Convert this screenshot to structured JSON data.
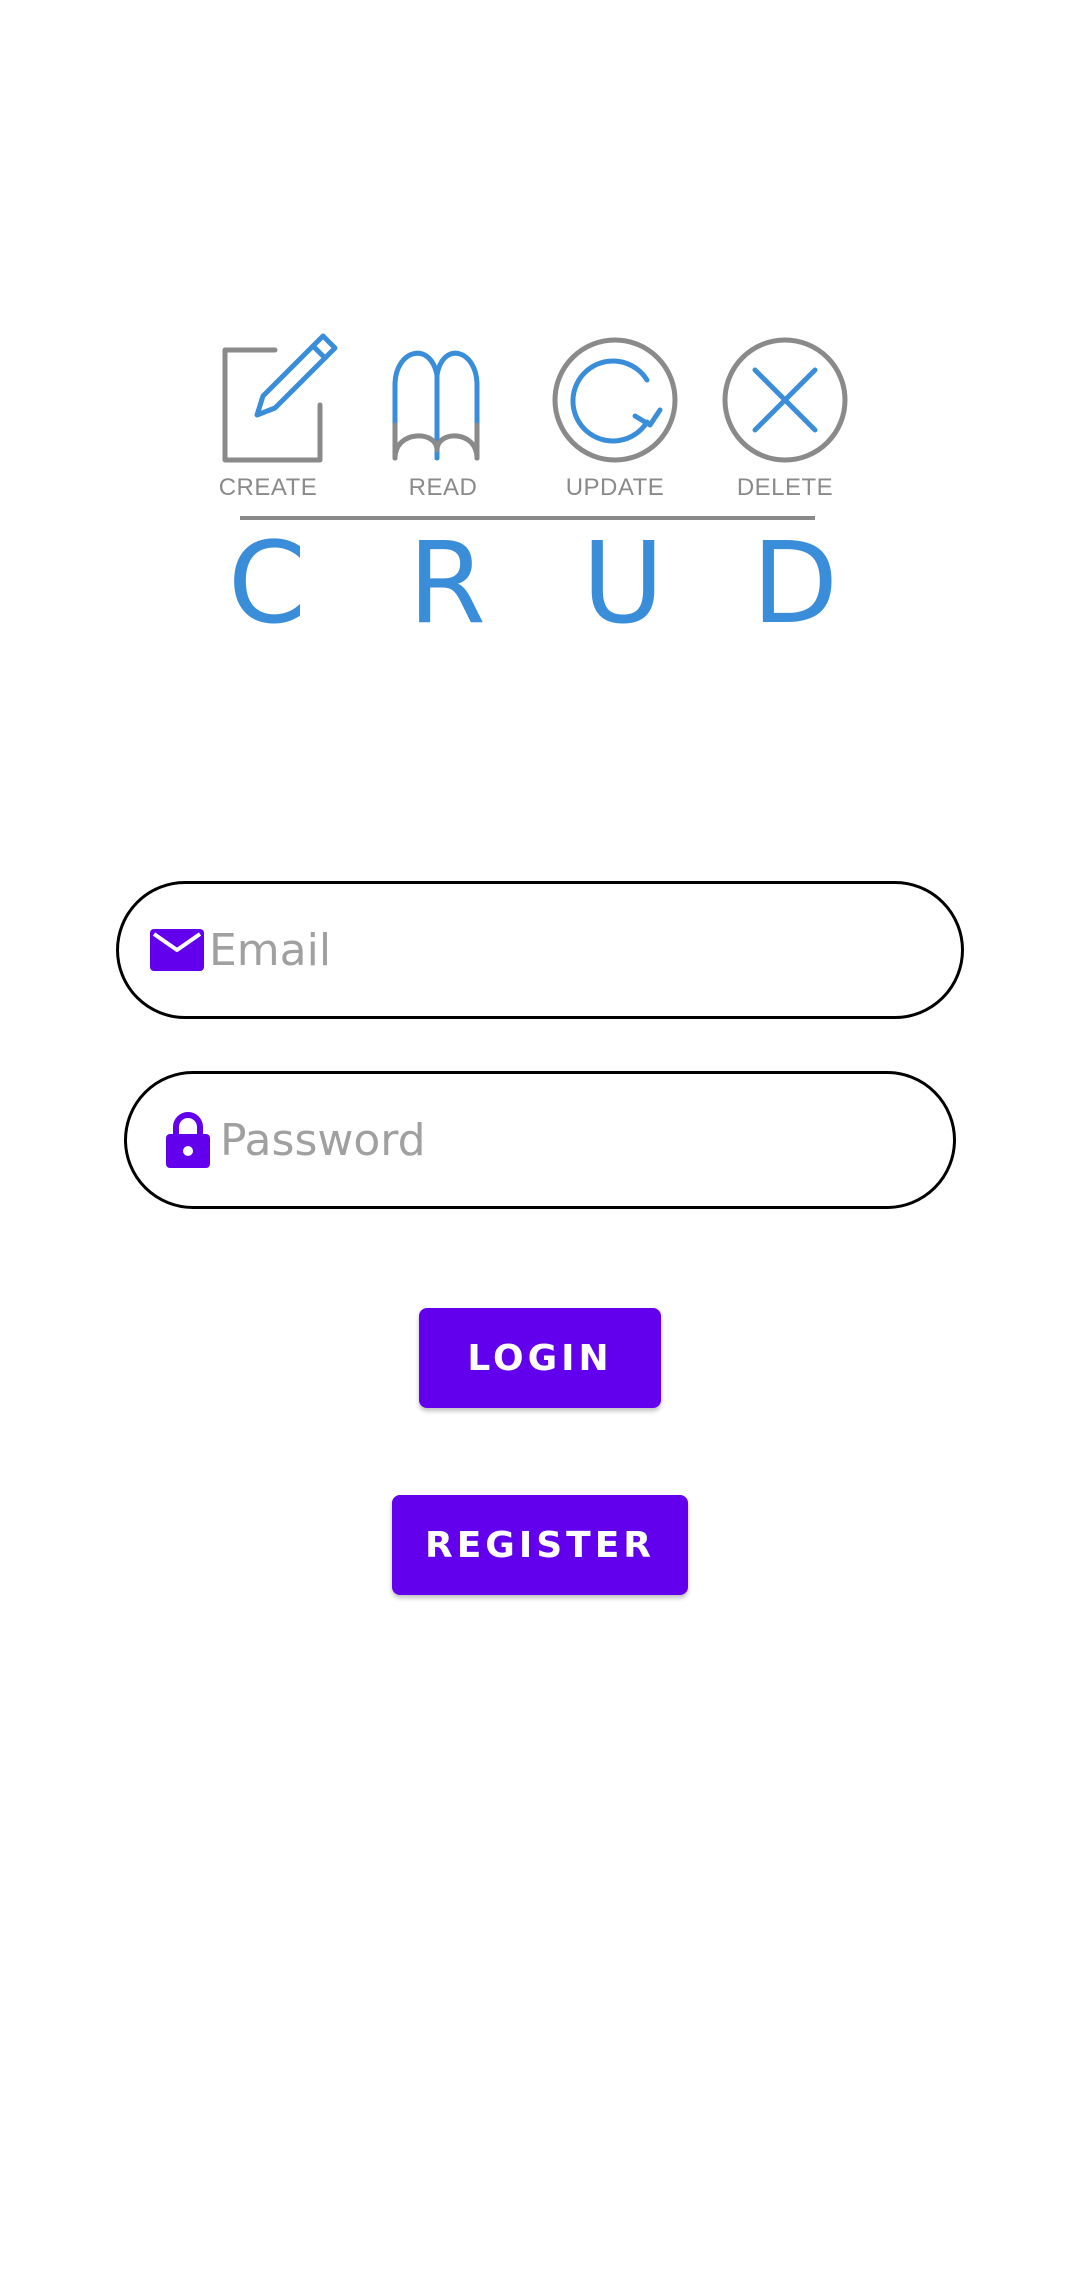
{
  "logo": {
    "labels": {
      "create": "CREATE",
      "read": "READ",
      "update": "UPDATE",
      "delete": "DELETE"
    },
    "letters": [
      "C",
      "R",
      "U",
      "D"
    ],
    "colors": {
      "blue": "#3a8ed9",
      "gray": "#8a8a8a"
    }
  },
  "form": {
    "email": {
      "icon": "mail-icon",
      "value": "",
      "placeholder": "Email"
    },
    "password": {
      "icon": "lock-icon",
      "value": "",
      "placeholder": "Password"
    }
  },
  "buttons": {
    "login_label": "LOGIN",
    "register_label": "REGISTER"
  },
  "theme": {
    "accent": "#6200ee",
    "field_border": "#000000",
    "placeholder_color": "#a0a0a0"
  }
}
